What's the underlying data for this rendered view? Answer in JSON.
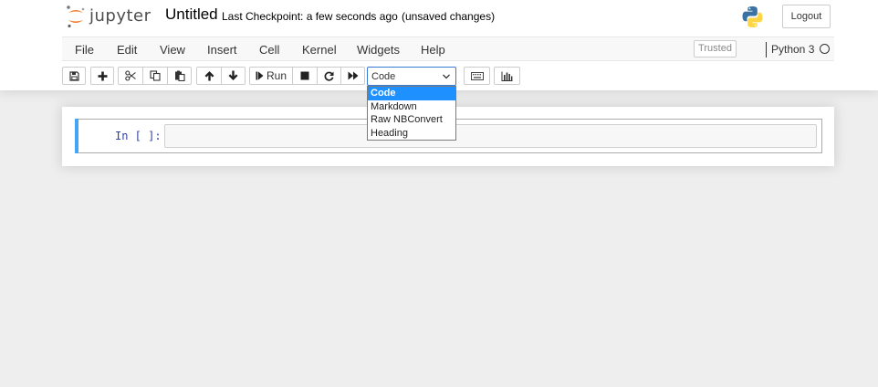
{
  "header": {
    "logo_text": "jupyter",
    "notebook_name": "Untitled",
    "checkpoint": "Last Checkpoint: a few seconds ago",
    "autosave_status": "(unsaved changes)",
    "logout_label": "Logout"
  },
  "menubar": {
    "items": [
      "File",
      "Edit",
      "View",
      "Insert",
      "Cell",
      "Kernel",
      "Widgets",
      "Help"
    ],
    "trusted_label": "Trusted",
    "kernel_name": "Python 3",
    "kernel_status": "idle"
  },
  "toolbar": {
    "buttons": [
      {
        "name": "save-checkpoint",
        "icon": "floppy-disk-icon"
      },
      {
        "name": "insert-cell-below",
        "icon": "plus-icon"
      },
      {
        "name": "cut-cells",
        "icon": "scissors-icon"
      },
      {
        "name": "copy-cells",
        "icon": "copy-icon"
      },
      {
        "name": "paste-cells",
        "icon": "paste-icon"
      },
      {
        "name": "move-cells-up",
        "icon": "arrow-up-icon"
      },
      {
        "name": "move-cells-down",
        "icon": "arrow-down-icon"
      },
      {
        "name": "run",
        "icon": "step-forward-icon"
      },
      {
        "name": "interrupt-kernel",
        "icon": "stop-icon"
      },
      {
        "name": "restart-kernel",
        "icon": "redo-icon"
      },
      {
        "name": "restart-run-all",
        "icon": "fast-forward-icon"
      },
      {
        "name": "command-palette",
        "icon": "keyboard-icon"
      },
      {
        "name": "cell-toolbar",
        "icon": "bar-chart-icon"
      }
    ],
    "run_label": "Run",
    "celltype_value": "Code",
    "celltype_options": [
      "Code",
      "Markdown",
      "Raw NBConvert",
      "Heading"
    ],
    "celltype_selected_index": 0
  },
  "notebook": {
    "cells": [
      {
        "prompt": "In [ ]:",
        "source": ""
      }
    ]
  },
  "colors": {
    "cell_selected_bar": "#42a5f5",
    "dropdown_highlight": "#1e90ff",
    "prompt_color": "#303f9f",
    "logo_orange": "#f37626"
  }
}
